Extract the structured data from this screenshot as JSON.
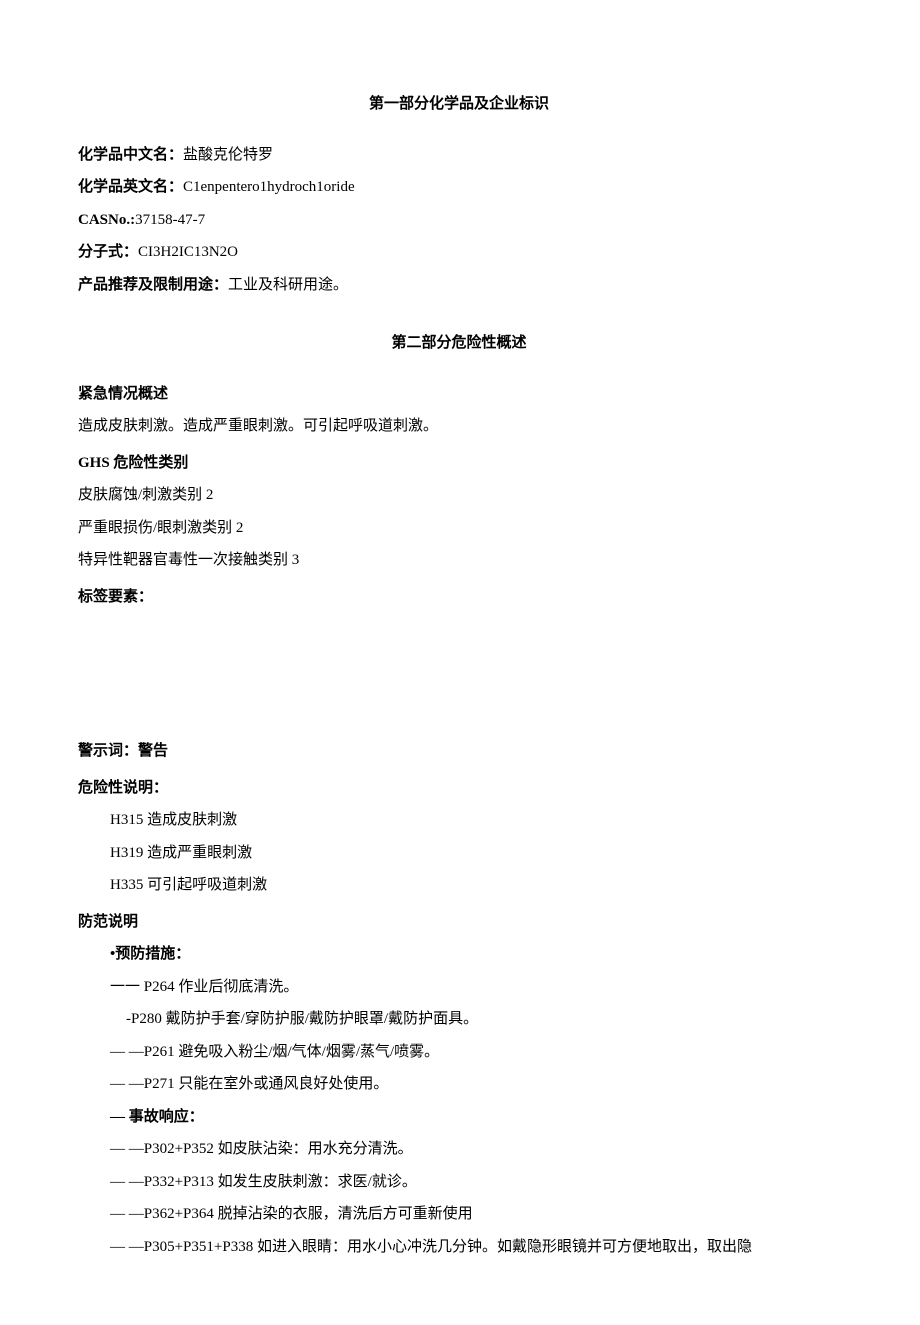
{
  "section1": {
    "title": "第一部分化学品及企业标识",
    "name_cn_label": "化学品中文名：",
    "name_cn_value": "盐酸克伦特罗",
    "name_en_label": "化学品英文名：",
    "name_en_value": "C1enpentero1hydroch1oride",
    "cas_label": "CASNo.:",
    "cas_value": "37158-47-7",
    "formula_label": "分子式：",
    "formula_value": "CI3H2IC13N2O",
    "use_label": "产品推荐及限制用途：",
    "use_value": "工业及科研用途。"
  },
  "section2": {
    "title": "第二部分危险性概述",
    "emergency_head": "紧急情况概述",
    "emergency_text": "造成皮肤刺激。造成严重眼刺激。可引起呼吸道刺激。",
    "ghs_head": "GHS 危险性类别",
    "ghs_items": [
      "皮肤腐蚀/刺激类别 2",
      "严重眼损伤/眼刺激类别 2",
      "特异性靶器官毒性一次接触类别 3"
    ],
    "label_elements_head": "标签要素：",
    "signal_word_label": "警示词：",
    "signal_word_value": "警告",
    "hazard_head": "危险性说明：",
    "hazard_items": [
      "H315 造成皮肤刺激",
      "H319 造成严重眼刺激",
      "H335 可引起呼吸道刺激"
    ],
    "prec_head": "防范说明",
    "prevention_head": "•预防措施：",
    "prevention_items": [
      "一一 P264 作业后彻底清洗。",
      "-P280 戴防护手套/穿防护服/戴防护眼罩/戴防护面具。",
      "—  —P261 避免吸入粉尘/烟/气体/烟雾/蒸气/喷雾。",
      "— —P271 只能在室外或通风良好处使用。"
    ],
    "response_head": "— 事故响应：",
    "response_items": [
      "— —P302+P352 如皮肤沾染：用水充分清洗。",
      "— —P332+P313 如发生皮肤刺激：求医/就诊。",
      "—  —P362+P364 脱掉沾染的衣服，清洗后方可重新使用",
      "—  —P305+P351+P338 如进入眼睛：用水小心冲洗几分钟。如戴隐形眼镜并可方便地取出，取出隐"
    ]
  }
}
